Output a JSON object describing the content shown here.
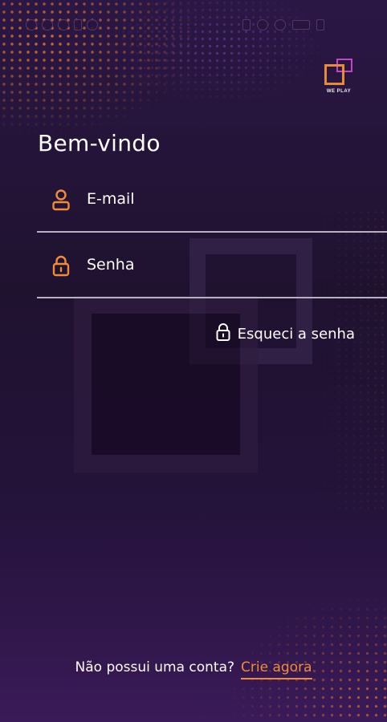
{
  "colors": {
    "accent": "#f08c38",
    "background": "#24133a",
    "text": "#ffffff",
    "brand_purple": "#c045c8"
  },
  "brand": {
    "logo_text": "WE PLAY"
  },
  "title": "Bem-vindo",
  "form": {
    "email": {
      "placeholder": "E-mail",
      "value": "",
      "icon": "user-icon"
    },
    "password": {
      "placeholder": "Senha",
      "value": "",
      "icon": "lock-icon"
    }
  },
  "forgot_password": {
    "label": "Esqueci a senha",
    "icon": "lock-icon"
  },
  "signup": {
    "prompt": "Não possui uma conta?",
    "link": "Crie agora"
  }
}
